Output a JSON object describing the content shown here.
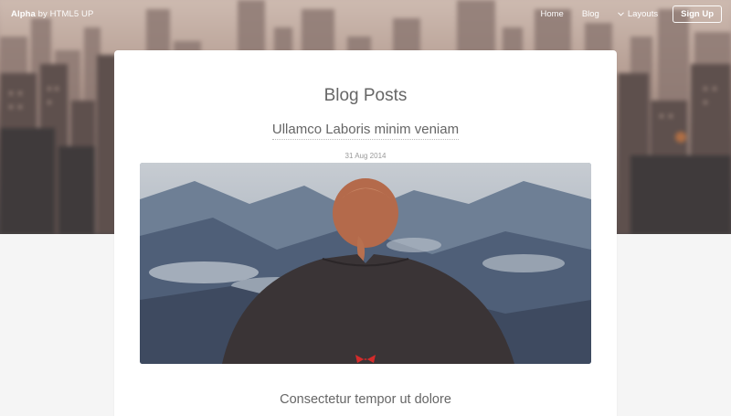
{
  "header": {
    "brand_bold": "Alpha",
    "brand_rest": "by HTML5 UP",
    "nav": {
      "home": "Home",
      "blog": "Blog",
      "layouts": "Layouts",
      "signup": "Sign Up"
    }
  },
  "main": {
    "title": "Blog Posts",
    "post": {
      "title": "Ullamco Laboris minim veniam",
      "date": "31 Aug 2014"
    },
    "next_heading": "Consectetur tempor ut dolore"
  },
  "colors": {
    "page_bg": "#f5f5f5",
    "card_bg": "#ffffff",
    "heading_text": "#666666",
    "date_text": "#999999",
    "header_text": "#ffffff"
  },
  "icons": {
    "layouts_dropdown": "chevron-down-icon"
  }
}
